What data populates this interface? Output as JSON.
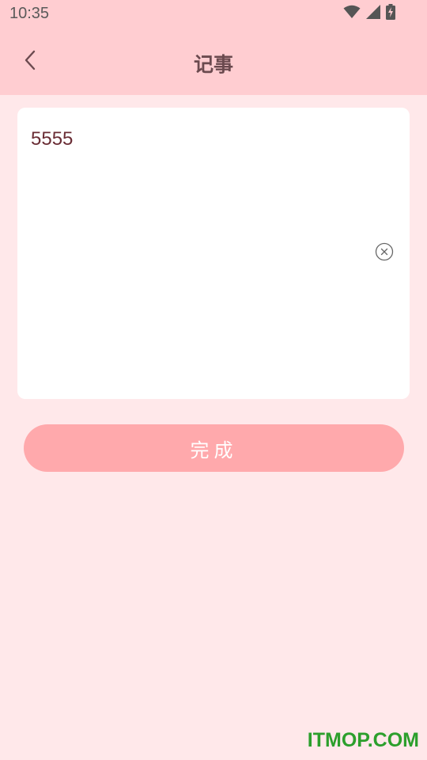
{
  "status_bar": {
    "time": "10:35",
    "icons": [
      "wifi-icon",
      "signal-icon",
      "battery-charging-icon"
    ]
  },
  "app_bar": {
    "back_icon": "chevron-left-icon",
    "title": "记事"
  },
  "note": {
    "content": "5555",
    "clear_icon": "clear-circle-icon"
  },
  "actions": {
    "done_label": "完成"
  },
  "watermark": "ITMOP.COM",
  "colors": {
    "header_bg": "#ffcdd1",
    "page_bg": "#ffe8ea",
    "button_bg": "#ffa9ac",
    "title_text": "#6b4a4f",
    "note_text": "#6a2d35"
  }
}
